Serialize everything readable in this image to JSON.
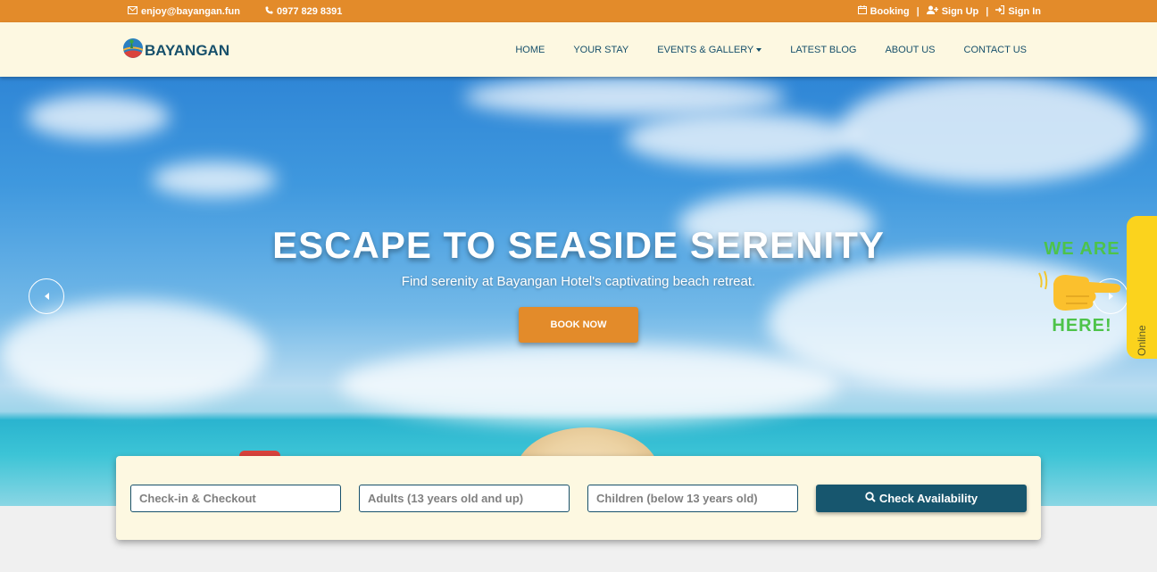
{
  "topbar": {
    "email": "enjoy@bayangan.fun",
    "phone": "0977 829 8391",
    "booking": "Booking",
    "signup": "Sign Up",
    "signin": "Sign In",
    "separator": "|"
  },
  "brand": {
    "name": "BAYANGAN"
  },
  "nav": {
    "items": [
      "HOME",
      "YOUR STAY",
      "EVENTS & GALLERY",
      "LATEST BLOG",
      "ABOUT US",
      "CONTACT US"
    ]
  },
  "hero": {
    "title": "ESCAPE TO SEASIDE SERENITY",
    "subtitle": "Find serenity at Bayangan Hotel's captivating beach retreat.",
    "cta": "BOOK NOW"
  },
  "widget": {
    "line1": "WE ARE",
    "line2": "HERE!",
    "tab_label": "Online"
  },
  "search": {
    "dates_placeholder": "Check-in & Checkout",
    "adults_placeholder": "Adults (13 years old and up)",
    "children_placeholder": "Children (below 13 years old)",
    "button": "Check Availability"
  },
  "colors": {
    "accent": "#e38b2a",
    "brand": "#17506b",
    "navbar_bg": "#fdf8e1",
    "widget_yellow": "#fbd31d",
    "widget_green": "#4ec34a"
  },
  "icons": {
    "email": "envelope-icon",
    "phone": "phone-icon",
    "booking": "calendar-icon",
    "signup": "user-plus-icon",
    "signin": "sign-in-icon",
    "search": "search-icon"
  }
}
